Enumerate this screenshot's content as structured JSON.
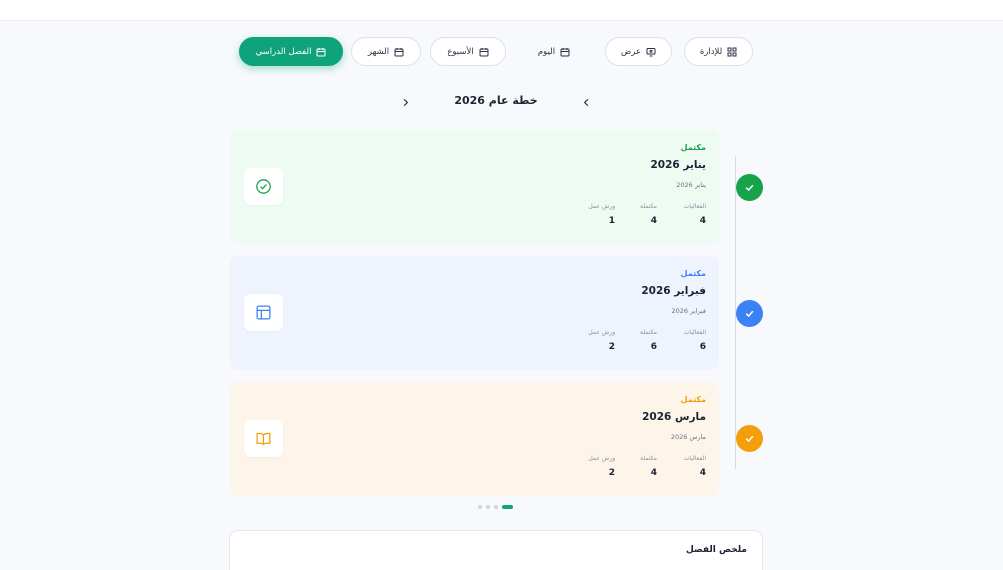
{
  "toolbar": {
    "admin_label": "للإدارة",
    "view_label": "عرض",
    "day_label": "اليوم",
    "week_label": "الأسبوع",
    "month_label": "الشهر",
    "semester_label": "الفصل الدراسي"
  },
  "nav": {
    "title": "خطة عام 2026"
  },
  "months": [
    {
      "status": "مكتمل",
      "name": "يناير 2026",
      "sub": "يناير 2026",
      "stats": {
        "events_label": "الفعاليات",
        "events": "4",
        "done_label": "مكتملة",
        "done": "4",
        "workshops_label": "ورش عمل",
        "workshops": "1"
      },
      "accent": "#16a34a",
      "bg": "#eefbf3",
      "icon": "check-circle-icon"
    },
    {
      "status": "مكتمل",
      "name": "فبراير 2026",
      "sub": "فبراير 2026",
      "stats": {
        "events_label": "الفعاليات",
        "events": "6",
        "done_label": "مكتملة",
        "done": "6",
        "workshops_label": "ورش عمل",
        "workshops": "2"
      },
      "accent": "#3b82f6",
      "bg": "#eef3fd",
      "icon": "layout-icon"
    },
    {
      "status": "مكتمل",
      "name": "مارس 2026",
      "sub": "مارس 2026",
      "stats": {
        "events_label": "الفعاليات",
        "events": "4",
        "done_label": "مكتملة",
        "done": "4",
        "workshops_label": "ورش عمل",
        "workshops": "2"
      },
      "accent": "#f59e0b",
      "bg": "#fdf5ea",
      "icon": "book-open-icon"
    }
  ],
  "summary": {
    "title": "ملخص الفصل"
  },
  "colors": {
    "primary": "#0ea37a"
  }
}
